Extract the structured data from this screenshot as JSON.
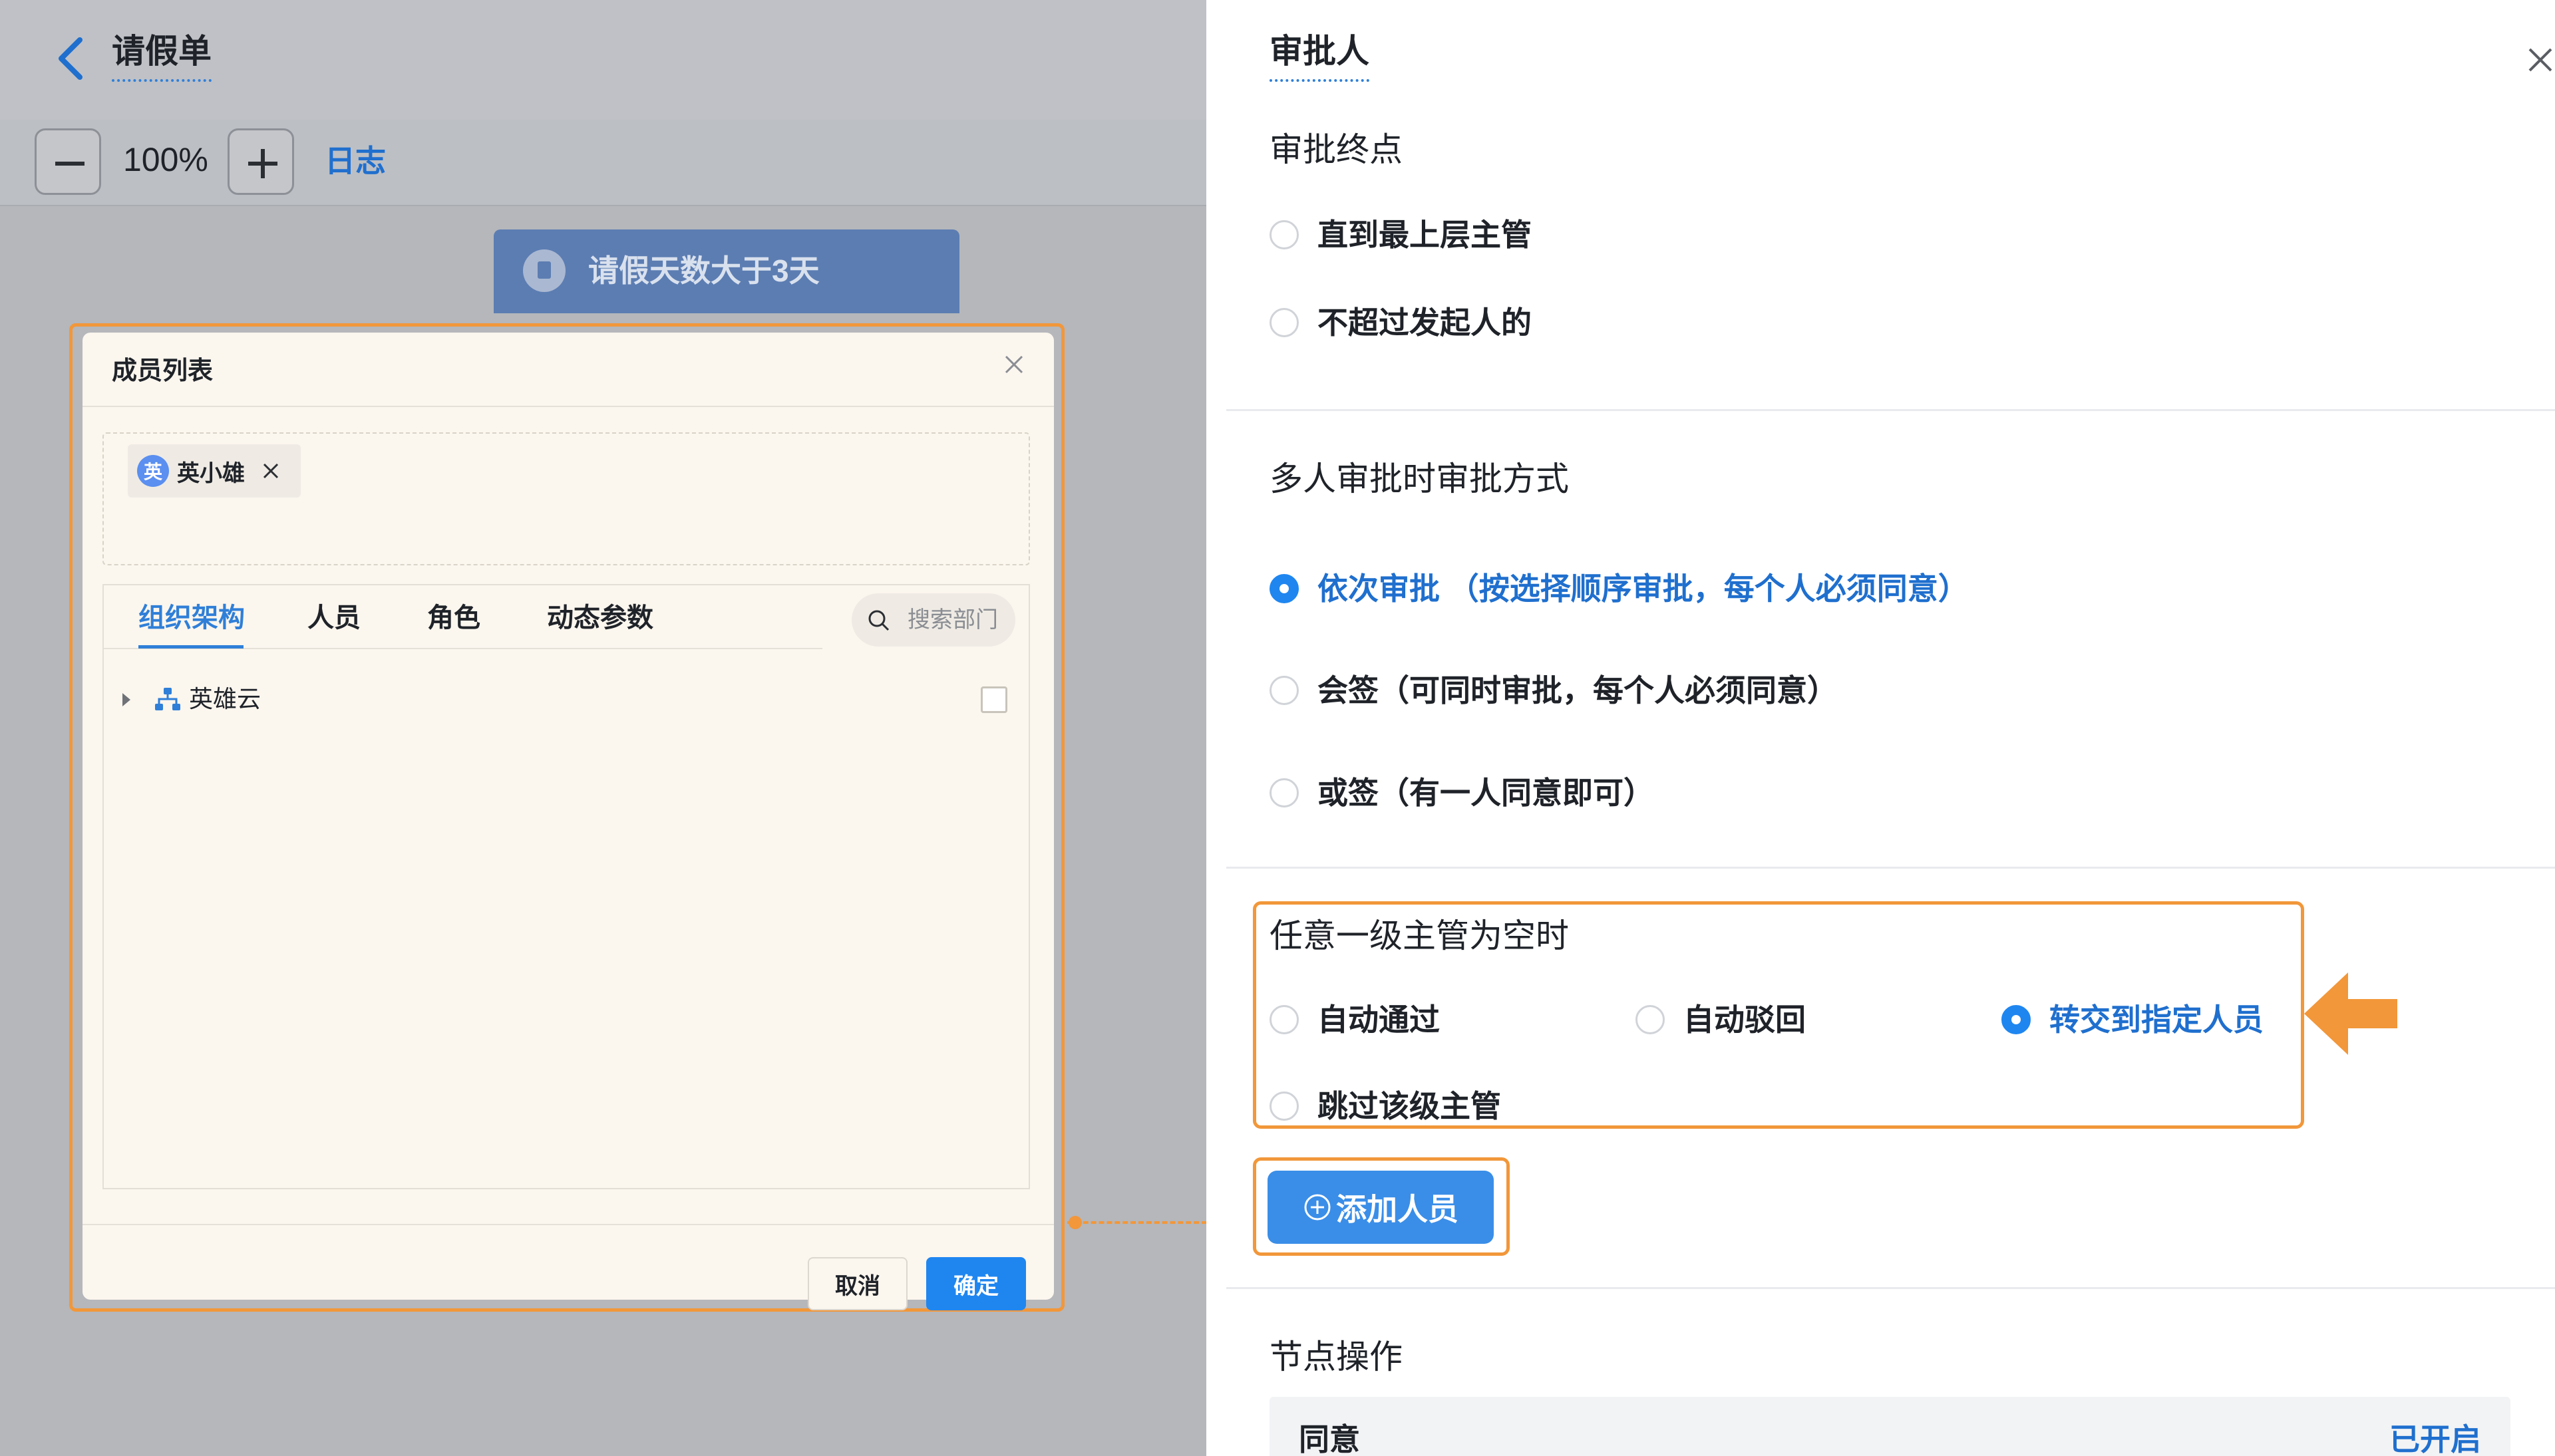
{
  "canvas": {
    "title": "请假单",
    "zoom": {
      "value": "100%",
      "log_label": "日志"
    },
    "condition_node": {
      "label": "请假天数大于3天"
    },
    "member_dialog": {
      "title": "成员列表",
      "selected": [
        {
          "avatar": "英",
          "name": "英小雄"
        }
      ],
      "tabs": [
        {
          "label": "组织架构",
          "active": true
        },
        {
          "label": "人员"
        },
        {
          "label": "角色"
        },
        {
          "label": "动态参数"
        }
      ],
      "search_placeholder": "搜索部门",
      "tree": [
        {
          "label": "英雄云"
        }
      ],
      "cancel_label": "取消",
      "ok_label": "确定"
    }
  },
  "panel": {
    "title": "审批人",
    "end_section": {
      "title": "审批终点",
      "options": [
        {
          "label": "直到最上层主管",
          "selected": false
        },
        {
          "label": "不超过发起人的",
          "selected": false
        }
      ]
    },
    "multi_section": {
      "title": "多人审批时审批方式",
      "options": [
        {
          "label": "依次审批 （按选择顺序审批，每个人必须同意）",
          "selected": true
        },
        {
          "label": "会签（可同时审批，每个人必须同意）",
          "selected": false
        },
        {
          "label": "或签（有一人同意即可）",
          "selected": false
        }
      ]
    },
    "empty_section": {
      "title": "任意一级主管为空时",
      "options": [
        {
          "label": "自动通过",
          "selected": false
        },
        {
          "label": "自动驳回",
          "selected": false
        },
        {
          "label": "转交到指定人员",
          "selected": true
        },
        {
          "label": "跳过该级主管",
          "selected": false
        }
      ]
    },
    "add_button_label": "添加人员",
    "node_ops": {
      "title": "节点操作",
      "row_name": "同意",
      "row_status": "已开启"
    },
    "accent_color": "#1f86f0",
    "highlight_color": "#f2973a"
  }
}
